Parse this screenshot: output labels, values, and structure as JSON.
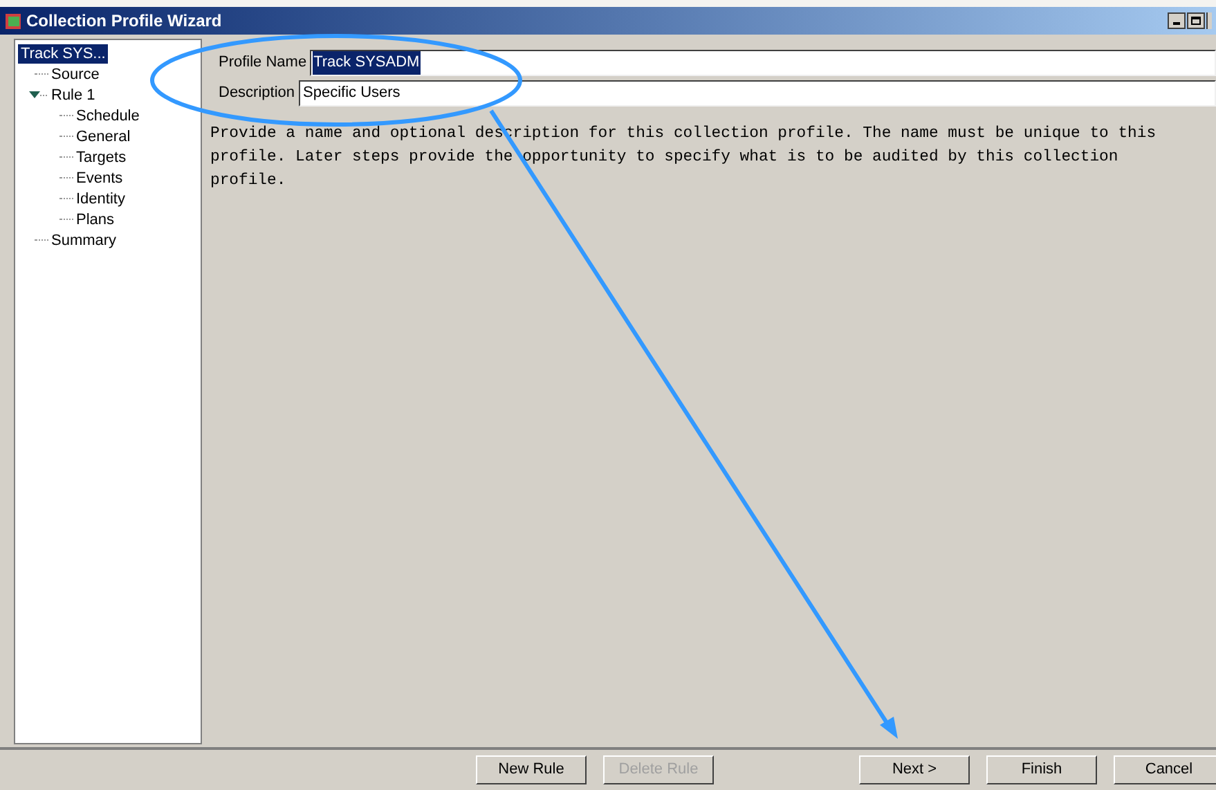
{
  "window": {
    "title": "Collection Profile Wizard"
  },
  "tree": [
    {
      "label": "Track SYS...",
      "selected": true,
      "children": [
        {
          "label": "Source",
          "selected": false
        },
        {
          "label": "Rule 1",
          "selected": false,
          "expanded": true,
          "children": [
            {
              "label": "Schedule",
              "selected": false
            },
            {
              "label": "General",
              "selected": false
            },
            {
              "label": "Targets",
              "selected": false
            },
            {
              "label": "Events",
              "selected": false
            },
            {
              "label": "Identity",
              "selected": false
            },
            {
              "label": "Plans",
              "selected": false
            }
          ]
        },
        {
          "label": "Summary",
          "selected": false
        }
      ]
    }
  ],
  "form": {
    "fields": [
      {
        "label": "Profile Name",
        "value": "Track SYSADM",
        "selected": true
      },
      {
        "label": "Description",
        "value": "Specific Users",
        "selected": false
      }
    ],
    "instructions": "Provide a name and optional description for this collection profile. The name must be unique to this profile. Later steps provide the opportunity to specify what is to be audited by this collection profile."
  },
  "buttons": [
    {
      "label": "New Rule",
      "disabled": false
    },
    {
      "label": "Delete Rule",
      "disabled": true
    },
    {
      "label": "Next >",
      "disabled": false
    },
    {
      "label": "Finish",
      "disabled": false
    },
    {
      "label": "Cancel",
      "disabled": false
    }
  ]
}
